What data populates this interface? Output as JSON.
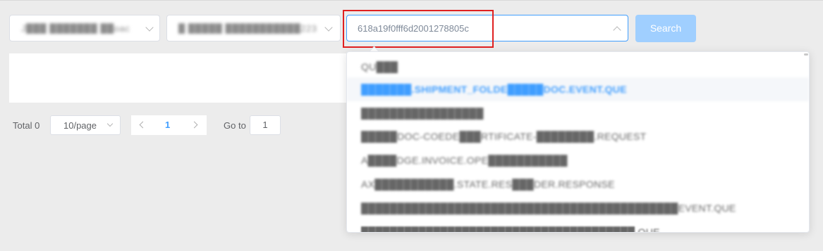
{
  "filters": {
    "select1_value": "J███ ███████ ██oac",
    "select2_value": "█ █████ ███████████223",
    "search_placeholder": "618a19f0fff6d2001278805c",
    "search_value": "",
    "search_button_label": "Search"
  },
  "pagination": {
    "total_label": "Total 0",
    "page_size": "10/page",
    "current_page": "1",
    "goto_label": "Go to",
    "goto_value": "1"
  },
  "dropdown": {
    "options": [
      "QU███",
      "███████.SHIPMENT_FOLDE█████DOC.EVENT.QUE",
      "█████████████████",
      "█████DOC-COEDE███RTIFICATE-████████.REQUEST",
      "A████DGE.INVOICE.OPE███████████",
      "AX███████████.STATE.RES███DER.RESPONSE",
      "████████████████████████████████████████████EVENT.QUE",
      "██████████████████████████████████████.QUE"
    ],
    "selected_index": 1
  },
  "colors": {
    "accent": "#409eff",
    "highlight_box": "#e02020",
    "search_button_disabled": "#a0cfff"
  }
}
